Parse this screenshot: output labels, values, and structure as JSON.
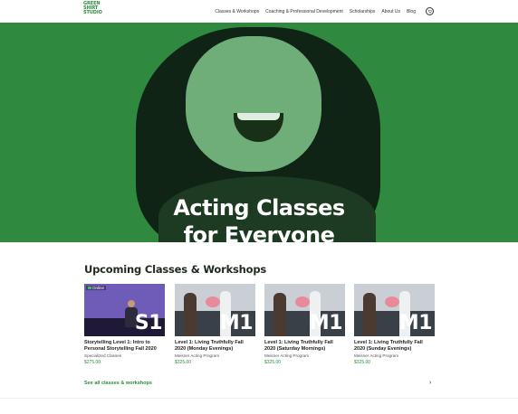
{
  "brand": {
    "logo_lines": [
      "GREEN",
      "SHIRT",
      "STUDIO"
    ]
  },
  "nav": {
    "items": [
      "Classes & Workshops",
      "Coaching & Professional Development",
      "Scholarships",
      "About Us",
      "Blog"
    ],
    "cart_icon": "cart-icon"
  },
  "hero": {
    "title_line1": "Acting Classes",
    "title_line2": "for Everyone",
    "tint_color": "#2f8a3f"
  },
  "section": {
    "title": "Upcoming Classes & Workshops"
  },
  "cards": [
    {
      "badge": "S1",
      "online_label": "Online",
      "title": "Storytelling Level 1: Intro to Personal Storytelling Fall 2020",
      "category": "Specialized Classes",
      "price": "$275.00"
    },
    {
      "badge": "M1",
      "title": "Level 1: Living Truthfully Fall 2020 (Monday Evenings)",
      "category": "Meisner Acting Program",
      "price": "$325.00"
    },
    {
      "badge": "M1",
      "title": "Level 1: Living Truthfully Fall 2020 (Saturday Mornings)",
      "category": "Meisner Acting Program",
      "price": "$325.00"
    },
    {
      "badge": "M1",
      "title": "Level 1: Living Truthfully Fall 2020 (Sunday Evenings)",
      "category": "Meisner Acting Program",
      "price": "$325.00"
    }
  ],
  "see_all": {
    "label": "See all classes & workshops",
    "arrow": "›"
  },
  "colors": {
    "brand_green": "#2e8b3e"
  }
}
